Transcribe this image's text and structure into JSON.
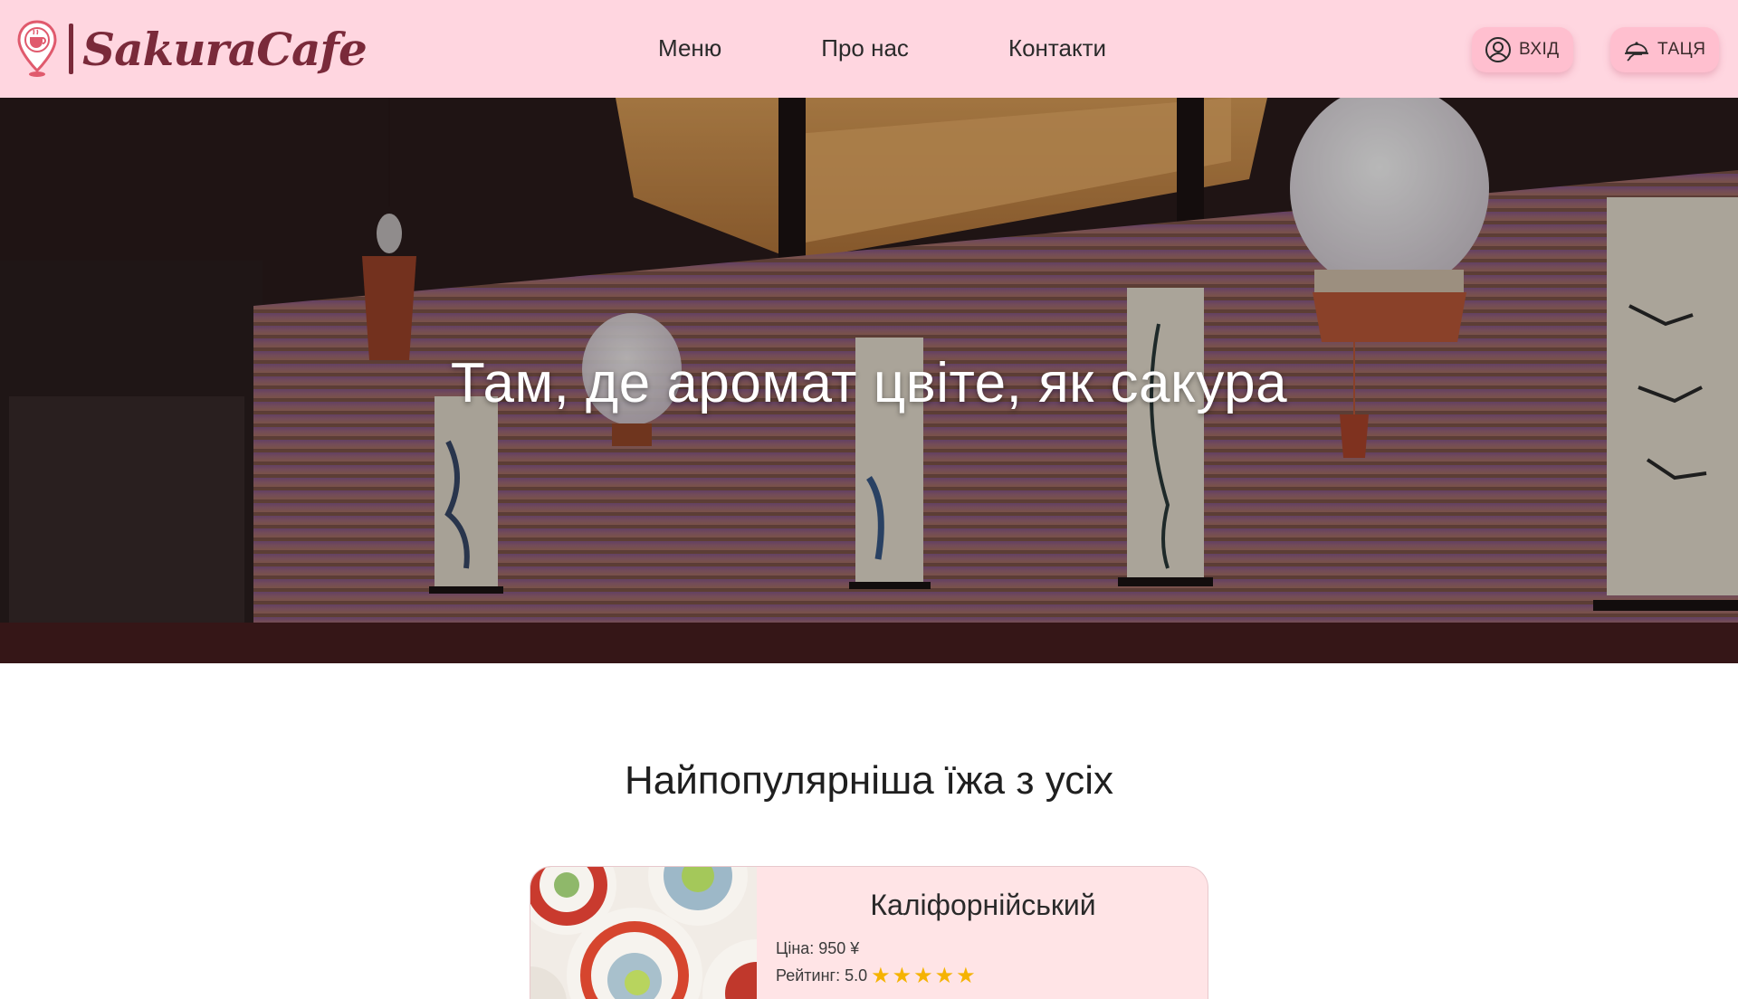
{
  "brand": {
    "name": "SakuraCafe",
    "accent": "#7a2a3a"
  },
  "nav": {
    "items": [
      "Меню",
      "Про нас",
      "Контакти"
    ]
  },
  "actions": {
    "login_label": "ВХІД",
    "tray_label": "ТАЦЯ"
  },
  "hero": {
    "title": "Там, де аромат цвіте, як сакура"
  },
  "popular": {
    "title": "Найпопулярніша їжа з усіх",
    "items": [
      {
        "name": "Каліфорнійський",
        "price": "Ціна: 950 ¥",
        "rating": "Рейтинг: 5.0",
        "stars": 5
      }
    ]
  },
  "colors": {
    "header_bg": "#ffd6e0",
    "button_bg": "#ffbfcf",
    "card_bg": "#ffe4e6",
    "star": "#f5b301"
  }
}
